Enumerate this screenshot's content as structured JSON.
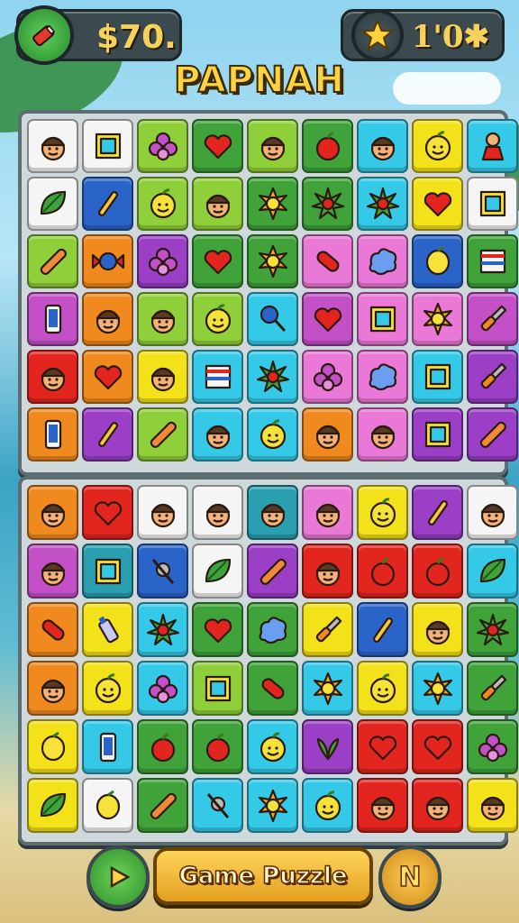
{
  "header": {
    "money_label": "$70.",
    "score_label": "1'0✱",
    "left_badge_icon": "battery-icon",
    "right_badge_icon": "star-icon"
  },
  "title": "PAPNAH",
  "footer": {
    "main_button_label": "Game Puzzle",
    "left_button_icon": "play-arrow-icon",
    "right_button_label": "N"
  },
  "colors": {
    "white": "#f5f5f5",
    "lime": "#8fcf3a",
    "green": "#3fa33a",
    "cyan": "#35c9e8",
    "yellow": "#f3e11a",
    "teal": "#2a9fb0",
    "blue": "#2b64c8",
    "orange": "#f08a1f",
    "purple": "#9a3fc6",
    "red": "#e2261f",
    "pink": "#ea78d6",
    "magenta": "#c450c8"
  },
  "top_board": [
    [
      {
        "color": "white",
        "icon": "face-icon"
      },
      {
        "color": "white",
        "icon": "frame-icon"
      },
      {
        "color": "lime",
        "icon": "orchid-icon"
      },
      {
        "color": "green",
        "icon": "heart-icon"
      },
      {
        "color": "lime",
        "icon": "face-icon"
      },
      {
        "color": "green",
        "icon": "apple-icon"
      },
      {
        "color": "cyan",
        "icon": "face-icon"
      },
      {
        "color": "yellow",
        "icon": "fruit-face-icon"
      },
      {
        "color": "cyan",
        "icon": "doll-icon"
      }
    ],
    [
      {
        "color": "white",
        "icon": "leaf-icon"
      },
      {
        "color": "blue",
        "icon": "wand-icon"
      },
      {
        "color": "lime",
        "icon": "fruit-face-icon"
      },
      {
        "color": "lime",
        "icon": "face-icon"
      },
      {
        "color": "green",
        "icon": "sun-icon"
      },
      {
        "color": "green",
        "icon": "burst-icon"
      },
      {
        "color": "cyan",
        "icon": "burst-icon"
      },
      {
        "color": "yellow",
        "icon": "heart-icon"
      },
      {
        "color": "white",
        "icon": "frame-icon"
      }
    ],
    [
      {
        "color": "lime",
        "icon": "pencil-icon"
      },
      {
        "color": "orange",
        "icon": "candy-icon"
      },
      {
        "color": "purple",
        "icon": "orchid-icon"
      },
      {
        "color": "green",
        "icon": "heart-icon"
      },
      {
        "color": "green",
        "icon": "sun-icon"
      },
      {
        "color": "pink",
        "icon": "capsule-icon"
      },
      {
        "color": "pink",
        "icon": "splash-icon"
      },
      {
        "color": "blue",
        "icon": "lemon-icon"
      },
      {
        "color": "green",
        "icon": "stripes-icon"
      }
    ],
    [
      {
        "color": "magenta",
        "icon": "phone-icon"
      },
      {
        "color": "orange",
        "icon": "face-icon"
      },
      {
        "color": "lime",
        "icon": "face-icon"
      },
      {
        "color": "lime",
        "icon": "fruit-face-icon"
      },
      {
        "color": "cyan",
        "icon": "lollipop-icon"
      },
      {
        "color": "magenta",
        "icon": "heart-icon"
      },
      {
        "color": "pink",
        "icon": "frame-icon"
      },
      {
        "color": "pink",
        "icon": "sun-icon"
      },
      {
        "color": "magenta",
        "icon": "screwdriver-icon"
      }
    ],
    [
      {
        "color": "red",
        "icon": "face-icon"
      },
      {
        "color": "orange",
        "icon": "heart-icon"
      },
      {
        "color": "yellow",
        "icon": "face-icon"
      },
      {
        "color": "cyan",
        "icon": "stripes-icon"
      },
      {
        "color": "cyan",
        "icon": "burst-icon"
      },
      {
        "color": "pink",
        "icon": "orchid-icon"
      },
      {
        "color": "pink",
        "icon": "splash-icon"
      },
      {
        "color": "cyan",
        "icon": "frame-icon"
      },
      {
        "color": "purple",
        "icon": "screwdriver-icon"
      }
    ],
    [
      {
        "color": "orange",
        "icon": "phone-icon"
      },
      {
        "color": "purple",
        "icon": "wand-icon"
      },
      {
        "color": "lime",
        "icon": "pencil-icon"
      },
      {
        "color": "cyan",
        "icon": "face-icon"
      },
      {
        "color": "cyan",
        "icon": "fruit-face-icon"
      },
      {
        "color": "orange",
        "icon": "face-icon"
      },
      {
        "color": "pink",
        "icon": "face-icon"
      },
      {
        "color": "purple",
        "icon": "frame-icon"
      },
      {
        "color": "purple",
        "icon": "pencil-icon"
      }
    ]
  ],
  "bottom_board": [
    [
      {
        "color": "orange",
        "icon": "face-icon"
      },
      {
        "color": "red",
        "icon": "heart-icon"
      },
      {
        "color": "white",
        "icon": "face-icon"
      },
      {
        "color": "white",
        "icon": "face-icon"
      },
      {
        "color": "teal",
        "icon": "face-icon"
      },
      {
        "color": "pink",
        "icon": "face-icon"
      },
      {
        "color": "yellow",
        "icon": "fruit-face-icon"
      },
      {
        "color": "purple",
        "icon": "wand-icon"
      },
      {
        "color": "white",
        "icon": "face-icon"
      }
    ],
    [
      {
        "color": "magenta",
        "icon": "face-icon"
      },
      {
        "color": "teal",
        "icon": "frame-icon"
      },
      {
        "color": "blue",
        "icon": "pin-icon"
      },
      {
        "color": "white",
        "icon": "leaf-icon"
      },
      {
        "color": "purple",
        "icon": "pencil-icon"
      },
      {
        "color": "red",
        "icon": "face-icon"
      },
      {
        "color": "red",
        "icon": "apple-icon"
      },
      {
        "color": "red",
        "icon": "apple-icon"
      },
      {
        "color": "cyan",
        "icon": "leaf-icon"
      }
    ],
    [
      {
        "color": "orange",
        "icon": "capsule-icon"
      },
      {
        "color": "yellow",
        "icon": "bottle-icon"
      },
      {
        "color": "cyan",
        "icon": "burst-icon"
      },
      {
        "color": "green",
        "icon": "heart-icon"
      },
      {
        "color": "green",
        "icon": "splash-icon"
      },
      {
        "color": "yellow",
        "icon": "screwdriver-icon"
      },
      {
        "color": "blue",
        "icon": "wand-icon"
      },
      {
        "color": "yellow",
        "icon": "face-icon"
      },
      {
        "color": "green",
        "icon": "burst-icon"
      }
    ],
    [
      {
        "color": "orange",
        "icon": "face-icon"
      },
      {
        "color": "yellow",
        "icon": "fruit-face-icon"
      },
      {
        "color": "cyan",
        "icon": "orchid-icon"
      },
      {
        "color": "lime",
        "icon": "frame-icon"
      },
      {
        "color": "green",
        "icon": "capsule-icon"
      },
      {
        "color": "cyan",
        "icon": "sun-icon"
      },
      {
        "color": "yellow",
        "icon": "fruit-face-icon"
      },
      {
        "color": "cyan",
        "icon": "sun-icon"
      },
      {
        "color": "green",
        "icon": "screwdriver-icon"
      }
    ],
    [
      {
        "color": "yellow",
        "icon": "lemon-icon"
      },
      {
        "color": "cyan",
        "icon": "phone-icon"
      },
      {
        "color": "green",
        "icon": "apple-icon"
      },
      {
        "color": "green",
        "icon": "apple-icon"
      },
      {
        "color": "cyan",
        "icon": "fruit-face-icon"
      },
      {
        "color": "purple",
        "icon": "plant-icon"
      },
      {
        "color": "red",
        "icon": "heart-icon"
      },
      {
        "color": "red",
        "icon": "heart-icon"
      },
      {
        "color": "green",
        "icon": "orchid-icon"
      }
    ],
    [
      {
        "color": "yellow",
        "icon": "leaf-icon"
      },
      {
        "color": "white",
        "icon": "lemon-icon"
      },
      {
        "color": "green",
        "icon": "pencil-icon"
      },
      {
        "color": "cyan",
        "icon": "pin-icon"
      },
      {
        "color": "cyan",
        "icon": "sun-icon"
      },
      {
        "color": "cyan",
        "icon": "fruit-face-icon"
      },
      {
        "color": "red",
        "icon": "face-icon"
      },
      {
        "color": "red",
        "icon": "face-icon"
      },
      {
        "color": "yellow",
        "icon": "face-icon"
      }
    ]
  ]
}
